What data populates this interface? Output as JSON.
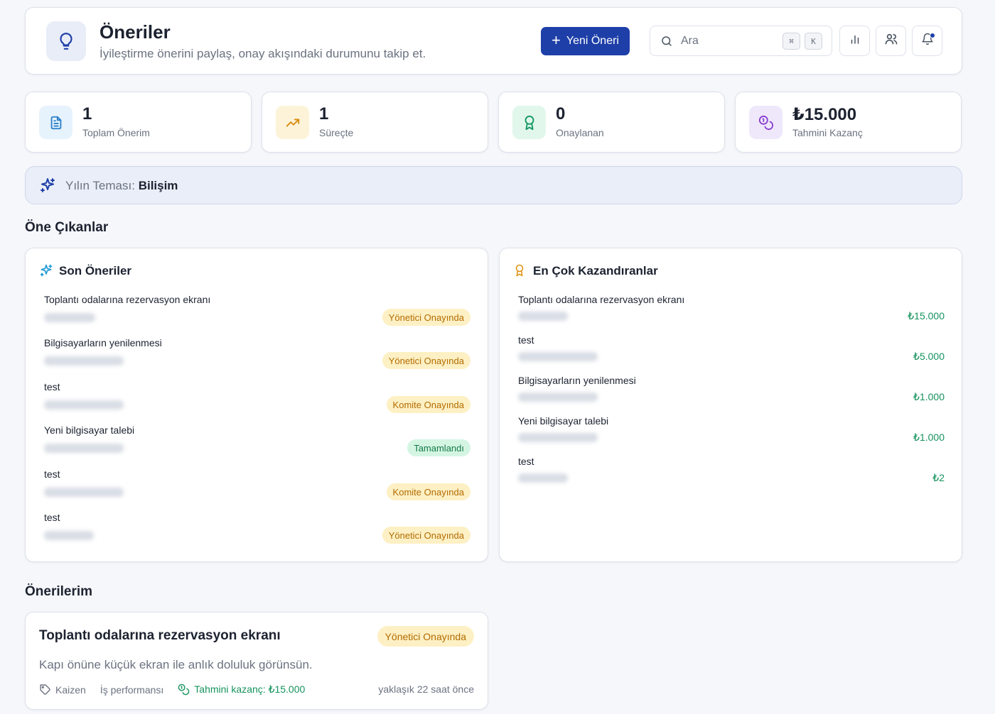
{
  "header": {
    "title": "Öneriler",
    "subtitle": "İyileştirme önerini paylaş, onay akışındaki durumunu takip et.",
    "new_button": "Yeni Öneri",
    "search_placeholder": "Ara",
    "kbd_cmd": "⌘",
    "kbd_k": "K"
  },
  "stats": [
    {
      "value": "1",
      "label": "Toplam Önerim",
      "icon": "document-icon",
      "color": "#e6f2fc"
    },
    {
      "value": "1",
      "label": "Süreçte",
      "icon": "trending-up-icon",
      "color": "#fdf3d8"
    },
    {
      "value": "0",
      "label": "Onaylanan",
      "icon": "award-icon",
      "color": "#e1f7ec"
    },
    {
      "value": "₺15.000",
      "label": "Tahmini Kazanç",
      "icon": "coins-icon",
      "color": "#efe8fb"
    }
  ],
  "theme": {
    "label": "Yılın Teması:",
    "value": "Bilişim"
  },
  "sections": {
    "highlights": "Öne Çıkanlar",
    "mine": "Önerilerim"
  },
  "recent": {
    "title": "Son Öneriler",
    "items": [
      {
        "title": "Toplantı odalarına rezervasyon ekranı",
        "status": "Yönetici Onayında",
        "tone": "yellow"
      },
      {
        "title": "Bilgisayarların yenilenmesi",
        "status": "Yönetici Onayında",
        "tone": "yellow"
      },
      {
        "title": "test",
        "status": "Komite Onayında",
        "tone": "yellow"
      },
      {
        "title": "Yeni bilgisayar talebi",
        "status": "Tamamlandı",
        "tone": "green"
      },
      {
        "title": "test",
        "status": "Komite Onayında",
        "tone": "yellow"
      },
      {
        "title": "test",
        "status": "Yönetici Onayında",
        "tone": "yellow"
      }
    ]
  },
  "top": {
    "title": "En Çok Kazandıranlar",
    "items": [
      {
        "title": "Toplantı odalarına rezervasyon ekranı",
        "amount": "₺15.000"
      },
      {
        "title": "test",
        "amount": "₺5.000"
      },
      {
        "title": "Bilgisayarların yenilenmesi",
        "amount": "₺1.000"
      },
      {
        "title": "Yeni bilgisayar talebi",
        "amount": "₺1.000"
      },
      {
        "title": "test",
        "amount": "₺2"
      }
    ]
  },
  "my": {
    "title": "Toplantı odalarına rezervasyon ekranı",
    "status": "Yönetici Onayında",
    "description": "Kapı önüne küçük ekran ile anlık doluluk görünsün.",
    "tag1": "Kaizen",
    "tag2": "İş performansı",
    "earn": "Tahmini kazanç: ₺15.000",
    "time": "yaklaşık 22 saat önce"
  }
}
